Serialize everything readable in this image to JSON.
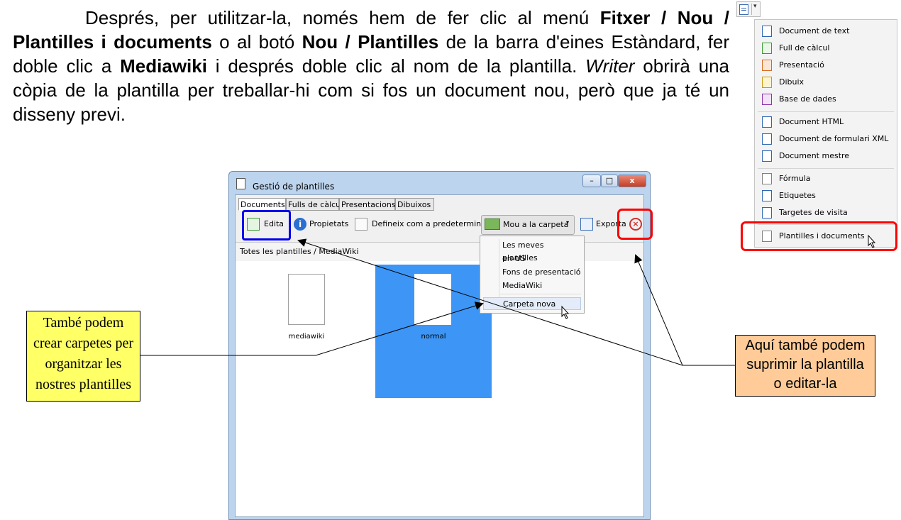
{
  "paragraph": {
    "t1": "Després, per utilitzar-la, només hem de fer clic al menú ",
    "b1": "Fitxer / Nou / Plantilles i documents",
    "t2": " o al botó ",
    "b2": "Nou / Plantilles",
    "t3": " de la barra d'eines Estàndard, fer doble clic a ",
    "b3": "Mediawiki",
    "t4": " i després doble clic al nom de la plantilla. ",
    "i1": "Writer",
    "t5": " obrirà una còpia de la plantilla per treballar-hi com si fos un document nou, però que ja té un disseny previ."
  },
  "new_menu": {
    "items": [
      "Document de text",
      "Full de càlcul",
      "Presentació",
      "Dibuix",
      "Base de dades",
      "Document HTML",
      "Document de formulari XML",
      "Document mestre",
      "Fórmula",
      "Etiquetes",
      "Targetes de visita",
      "Plantilles i documents"
    ]
  },
  "dialog": {
    "title": "Gestió de plantilles",
    "tabs": [
      "Documents",
      "Fulls de càlcul",
      "Presentacions",
      "Dibuixos"
    ],
    "toolbar": {
      "edit": "Edita",
      "properties": "Propietats",
      "set_default": "Defineix com a predeterminat",
      "move": "Mou a la carpeta",
      "export": "Exporta"
    },
    "path": "Totes les plantilles / MediaWiki",
    "thumbs": [
      "mediawiki",
      "normal"
    ],
    "move_menu": [
      "Les meves plantilles",
      "en-US",
      "Fons de presentació",
      "MediaWiki",
      "Carpeta nova"
    ]
  },
  "callouts": {
    "left": [
      "També podem",
      "crear carpetes per",
      "organitzar les",
      "nostres plantilles"
    ],
    "right": [
      "Aquí també podem",
      "suprimir la plantilla",
      "o editar-la"
    ]
  },
  "colors": {
    "left_callout": "#ffff66",
    "right_callout": "#ffcc99",
    "selection": "#3d95f5",
    "red_highlight": "#ff0000",
    "blue_highlight": "#0000ee"
  }
}
